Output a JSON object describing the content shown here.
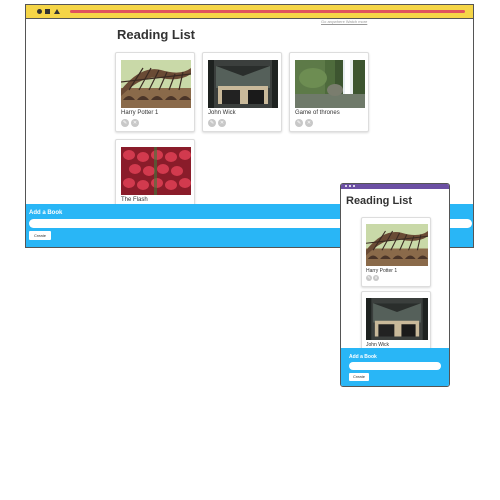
{
  "desktop": {
    "top_link": "Go anywhere Watch more",
    "title": "Reading List",
    "books": [
      {
        "name": "Harry Potter 1",
        "image": "arched-bridge-photo"
      },
      {
        "name": "John Wick",
        "image": "dark-interior-photo"
      },
      {
        "name": "Game of thrones",
        "image": "waterfall-photo"
      },
      {
        "name": "The Flash",
        "image": "strawberries-photo"
      }
    ],
    "add_form": {
      "title": "Add a Book",
      "input_value": "",
      "button_label": "Create"
    }
  },
  "mobile": {
    "title": "Reading List",
    "books": [
      {
        "name": "Harry Potter 1",
        "image": "arched-bridge-photo"
      },
      {
        "name": "John Wick",
        "image": "dark-interior-photo"
      }
    ],
    "add_form": {
      "title": "Add a Book",
      "input_value": "",
      "button_label": "Create"
    }
  },
  "colors": {
    "browser_bar": "#f5d547",
    "url_bar": "#e0525e",
    "mobile_bar": "#6b4fa3",
    "add_panel": "#29b6f6"
  },
  "icons": [
    "circle-icon",
    "square-icon",
    "triangle-icon",
    "edit-icon",
    "delete-icon"
  ]
}
